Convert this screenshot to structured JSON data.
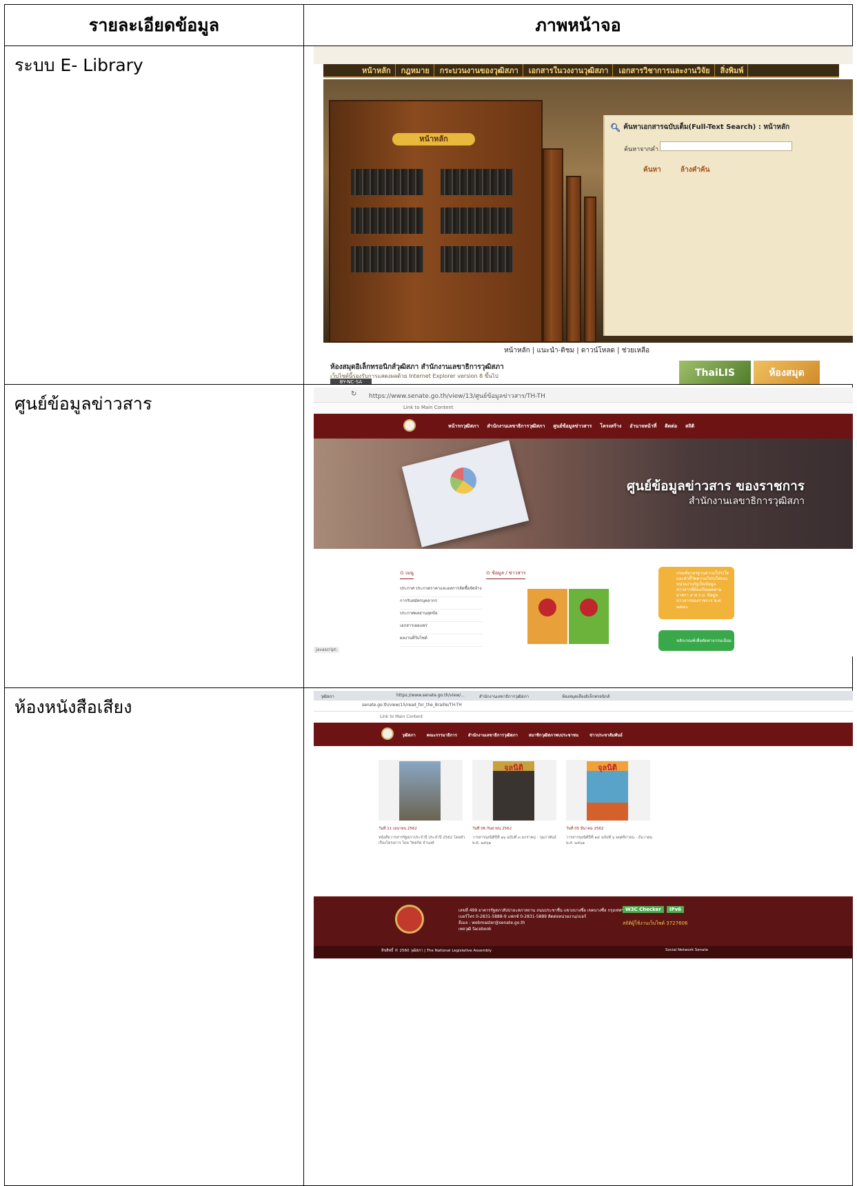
{
  "table": {
    "header_desc": "รายละเอียดข้อมูล",
    "header_screen": "ภาพหน้าจอ"
  },
  "rows": [
    {
      "desc": "ระบบ E- Library"
    },
    {
      "desc": "ศูนย์ข้อมูลข่าวสาร"
    },
    {
      "desc": "ห้องหนังสือเสียง"
    }
  ],
  "elib": {
    "menu": [
      "หน้าหลัก",
      "กฎหมาย",
      "กระบวนงานของวุฒิสภา",
      "เอกสารในวงงานวุฒิสภา",
      "เอกสารวิชาการและงานวิจัย",
      "สิ่งพิมพ์"
    ],
    "home_tag": "หน้าหลัก",
    "search_title": "ค้นหาเอกสารฉบับเต็ม(Full-Text Search) : หน้าหลัก",
    "search_label": "ค้นหาจากคำ",
    "search_button": "ค้นหา",
    "clear_button": "ล้างคำค้น",
    "footer_links": "หน้าหลัก | แนะนำ-ติชม | ดาวน์โหลด | ช่วยเหลือ",
    "footer_title": "ห้องสมุดอิเล็กทรอนิกส์วุฒิสภา สำนักงานเลขาธิการวุฒิสภา",
    "footer_note": "เว็บไซต์นี้รองรับการแสดงผลด้วย Internet Explorer version 8 ขึ้นไป",
    "cc_badge": "BY-NC-SA",
    "banner1": "ThaiLIS",
    "banner2": "ห้องสมุด"
  },
  "info": {
    "url": "https://www.senate.go.th/view/13/ศูนย์ข้อมูลข่าวสาร/TH-TH",
    "skip_link": "Link to Main Content",
    "nav": [
      "หน้ารกวุฒิสภา",
      "สำนักงานเลขาธิการวุฒิสภา",
      "ศูนย์ข้อมูลข่าวสาร",
      "โครงสร้าง",
      "อำนาจหน้าที่",
      "ติดต่อ",
      "สถิติ"
    ],
    "hero_title": "ศูนย์ข้อมูลข่าวสาร ของราชการ",
    "hero_sub": "สำนักงานเลขาธิการวุฒิสภา",
    "menu_head": "⊙ เมนู",
    "menu_items": [
      "ประกาศ ประกวดราคาและผลการจัดซื้อจัดจ้าง",
      "การรับสมัครบุคลากร",
      "ประกาศผลอ่านสุดข้อ",
      "เอกสารเผยแพร่",
      "ผลงานที่วับไซต์"
    ],
    "news_head": "⊙ ข้อมูล / ข่าวสาร",
    "promo_text": "เกณฑ์มาตรฐานความโปร่งใส และตัวชี้วัดความโปร่งใสของหน่วยงานรัฐเป็นข้อมูลข่าวสารที่ต้องเปิดเผยตามมาตรา ๙ พ.ร.บ. ข้อมูลข่าวสารของราชการ พ.ศ. ๒๕๔๐",
    "promo2_text": "หลักเกณฑ์เพื่อตัดค่าธรรมเนียม",
    "status": "javascript:"
  },
  "audio": {
    "tabs": [
      "วุฒิสภา",
      "https://www.senate.go.th/view/...",
      "สำนักงานเลขาธิการวุฒิสภา",
      "ห้องสมุดเสียงอิเล็กทรอนิกส์"
    ],
    "url": "senate.go.th/view/15/read_for_the_Braille/TH-TH",
    "skip_link": "Link to Main Content",
    "nav": [
      "วุฒิสภา",
      "คณะกรรมาธิการ",
      "สำนักงานเลขาธิการวุฒิสภา",
      "สมาชิกวุฒิสภาพบประชาชน",
      "ข่าวประชาสัมพันธ์"
    ],
    "cards": [
      {
        "date": "วันที่ 11 เมษายน 2562",
        "caption": "หนังสือวารสารรัฐสภาประจำปี ประจำปี 2562 โดยหัวเรื่องโครงการ โดย วิทยกิต จำนงค์"
      },
      {
        "date": "วันที่ 06 กันยายน 2562",
        "caption": "วารสารจุลนิติปีที่ ๑๖ ฉบับที่ ๓ มกราคม - กุมภาพันธ์ พ.ศ. ๒๕๖๒"
      },
      {
        "date": "วันที่ 05 มีนาคม 2562",
        "caption": "วารสารจุลนิติปีที่ ๑๕ ฉบับที่ ๖ พฤศจิกายน - ธันวาคม พ.ศ. ๒๕๖๑"
      }
    ],
    "cover_title": "จุลนิติ",
    "footer_addr": [
      "เลขที่ 499 อาคารรัฐสภาสัปปายะสภาสถาน ถนนประชาชื่น แขวงบางซื่อ เขตบางซื่อ กรุงเทพฯ 10800",
      "เบอร์โทร 0-2831-5888-9 แฟกซ์ 0-2831-5889 ติดต่อหน่วยงาน/เบอร์",
      "อีเมล : webmaster@senate.go.th",
      "เพจวุฒิ facebook"
    ],
    "badges": [
      "W3C Checker",
      "IPv6"
    ],
    "visitor_label": "สถิติผู้ใช้งานเว็บไซต์ 3727606",
    "copyright": "ลิขสิทธิ์ © 2560 วุฒิสภา | The National Legislative Assembly",
    "social": "Social Network Senate"
  }
}
